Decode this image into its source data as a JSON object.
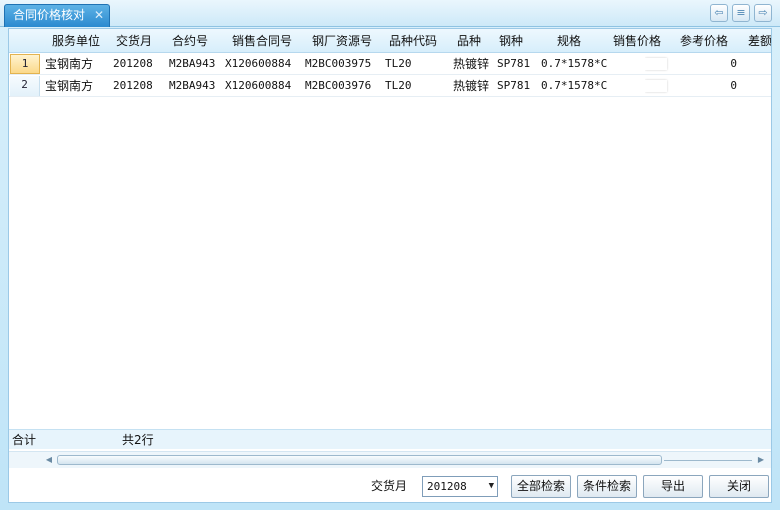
{
  "tab": {
    "title": "合同价格核对",
    "close": "✕"
  },
  "toolbar": {
    "prev": "⇦",
    "menu": "≡",
    "next": "⇨"
  },
  "columns": [
    "服务单位",
    "交货月",
    "合约号",
    "销售合同号",
    "钢厂资源号",
    "品种代码",
    "品种",
    "钢种",
    "规格",
    "销售价格",
    "参考价格",
    "差额"
  ],
  "rows": [
    {
      "num": "1",
      "cells": [
        "宝钢南方",
        "201208",
        "M2BA943",
        "X120600884",
        "M2BC003975",
        "TL20",
        "热镀锌",
        "SP781",
        "0.7*1578*C",
        "",
        "0",
        ""
      ]
    },
    {
      "num": "2",
      "cells": [
        "宝钢南方",
        "201208",
        "M2BA943",
        "X120600884",
        "M2BC003976",
        "TL20",
        "热镀锌",
        "SP781",
        "0.7*1578*C",
        "",
        "0",
        ""
      ]
    }
  ],
  "summary": {
    "label": "合计",
    "count": "共2行"
  },
  "filter": {
    "label": "交货月",
    "value": "201208",
    "dropdown": "▼"
  },
  "buttons": {
    "all_search": "全部检索",
    "cond_search": "条件检索",
    "export": "导出",
    "close": "关闭"
  },
  "scroll": {
    "left": "◀",
    "right": "▶"
  }
}
